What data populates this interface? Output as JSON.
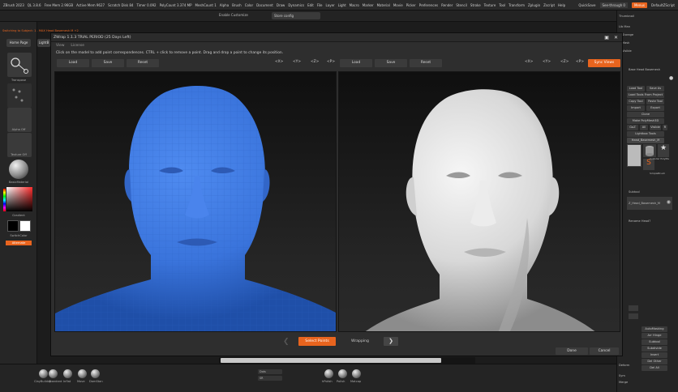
{
  "menubar": {
    "app": "ZBrush 2023",
    "ql": "QL 3.8.6",
    "items": [
      "Free Mem 2.96GB",
      "Active Mem 9627",
      "Scratch Disk 84",
      "Timer 0.092",
      "PolyCount 3.374 MP",
      "MeshCount 1"
    ],
    "menus": [
      "Alpha",
      "Brush",
      "Color",
      "Document",
      "Draw",
      "Dynamics",
      "Edit",
      "File",
      "Layer",
      "Light",
      "Macro",
      "Marker",
      "Material",
      "Movie",
      "Picker",
      "Preferences",
      "Render",
      "Stencil",
      "Stroke",
      "Texture",
      "Tool",
      "Transform",
      "Zplugin",
      "Zscript",
      "Help"
    ],
    "quicksave": "QuickSave",
    "see_through": "See-through 0",
    "menus_btn": "Menus",
    "default_zscript": "DefaultZScript"
  },
  "strip2": {
    "label": "Enable Customize",
    "field": "Store config"
  },
  "left": {
    "subtitle": "Switching to Subject: 1 . MAX Head Basemesh M +2",
    "home_page": "Home Page",
    "lightbox": "LightB",
    "brush_label": "Transpose",
    "alpha_label": "Alpha Off",
    "texture_label": "Texture Off",
    "material_label": "BasicMaterial",
    "gradient_label": "Gradient",
    "switch_color_label": "SwitchColor",
    "alternate_label": "Alternate"
  },
  "zwrap": {
    "title": "ZWrap 1.1.3 TRIAL PERIOD (25 Days Left)",
    "menu": [
      "View",
      "License"
    ],
    "instructions": "Click on the model to add point correspondences. CTRL + click to remove a point. Drag and drop a point to change its position.",
    "left_toolbar": {
      "load": "Load",
      "save": "Save",
      "reset": "Reset"
    },
    "axes": [
      "<X>",
      "<Y>",
      "<Z>",
      "<P>"
    ],
    "right_toolbar": {
      "load": "Load",
      "save": "Save",
      "reset": "Reset"
    },
    "sync_views": "Sync Views",
    "select_points": "Select Points",
    "wrapping": "Wrapping",
    "done": "Done",
    "cancel": "Cancel"
  },
  "right": {
    "thumbnail": "Thumbnail",
    "sub_items": [
      "Lib Man",
      "Storage",
      "Mask",
      "Visible"
    ],
    "title_label": "Base Head Basemesh",
    "buttons": [
      "Load Tool",
      "Save As",
      "Load Tools From Project",
      "Copy Tool",
      "Paste Tool",
      "Import",
      "Export",
      "Clone",
      "Make PolyMesh3D",
      "GoZ",
      "All",
      "Visible",
      "R",
      "Lightbox Tools"
    ],
    "tool_name": "Head_Basemesh_M",
    "tool_thumbs_labels": [
      "Cylinder PolyMe",
      "SimpleBrush"
    ],
    "subtool": "Subtool",
    "subtool_item": "Z_Head_Basemesh_M",
    "paint_label": "Rename Head?",
    "bottom_buttons": [
      "AutoMasking",
      "Arr Hinge",
      "Subtool",
      "Subdivide",
      "Insert",
      "Del Other",
      "Del All"
    ],
    "deform": "Deform",
    "geometry": "Sym",
    "merge": "Merge"
  },
  "bottom": {
    "brushes": [
      "ClayBuildup",
      "Standard",
      "Inflat",
      "Move",
      "DamStan"
    ],
    "right_brushes": [
      "hPolish",
      "Polish",
      "Matcap"
    ],
    "field1": "Dots",
    "field2": "SR"
  }
}
